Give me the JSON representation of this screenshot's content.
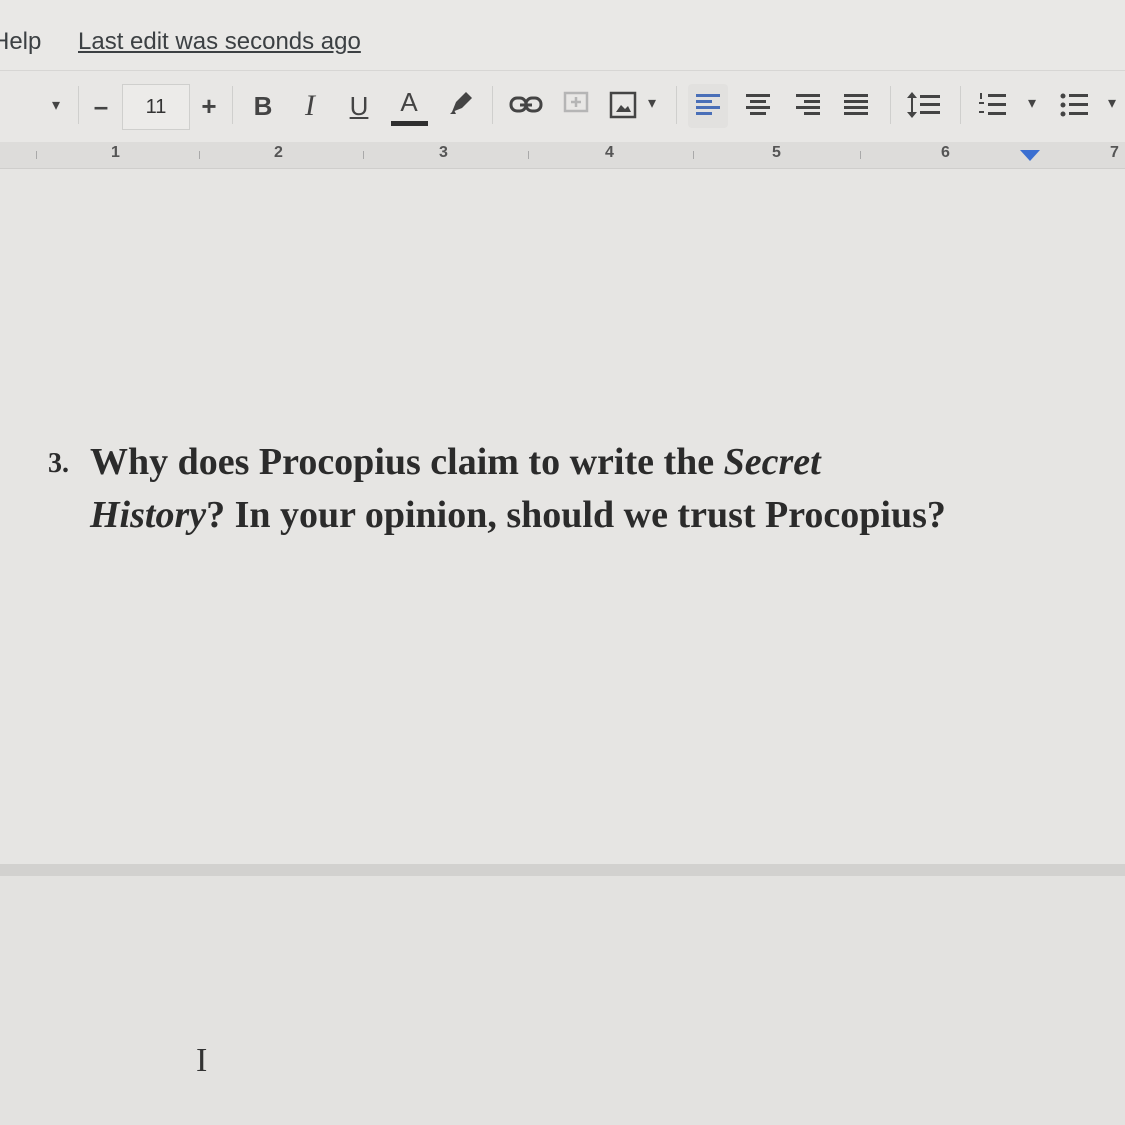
{
  "menu": {
    "help": "Help",
    "last_edit": "Last edit was seconds ago"
  },
  "toolbar": {
    "minus": "–",
    "font_size": "11",
    "plus": "+",
    "bold": "B",
    "italic": "I",
    "underline": "U",
    "text_color": "A",
    "dropdown_arrow": "▾",
    "text_color_underline": "#2f2f2f",
    "active_align_bg": "#d5dbe8"
  },
  "ruler": {
    "numbers": [
      "1",
      "2",
      "3",
      "4",
      "5",
      "6",
      "7"
    ]
  },
  "document": {
    "question_number": "3.",
    "line1_prefix": "Why does Procopius claim to write the ",
    "line1_italic": "Secret",
    "line2_italic": "History",
    "line2_suffix": "? In your opinion, should we trust Procopius?"
  },
  "icons": [
    "dropdown-arrow-icon",
    "highlighter-icon",
    "link-icon",
    "add-comment-icon",
    "insert-image-icon",
    "align-left-icon",
    "align-center-icon",
    "align-right-icon",
    "align-justify-icon",
    "line-spacing-icon",
    "numbered-list-icon",
    "bulleted-list-icon",
    "text-cursor-icon",
    "indent-marker-icon"
  ]
}
